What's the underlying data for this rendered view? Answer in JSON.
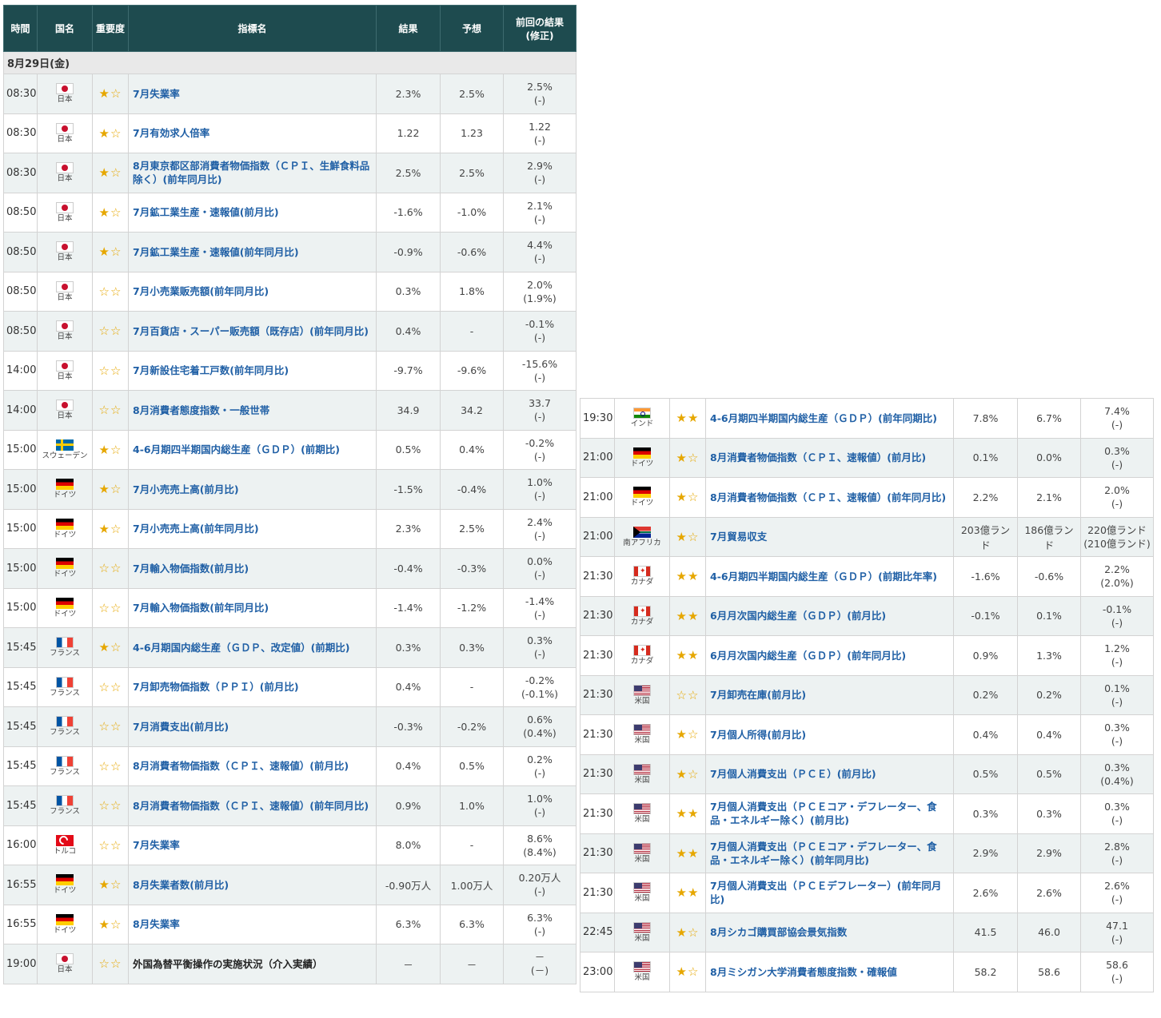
{
  "headers": {
    "time": "時間",
    "country": "国名",
    "importance": "重要度",
    "indicator": "指標名",
    "result": "結果",
    "forecast": "予想",
    "previous": "前回の結果",
    "previous_sub": "(修正)"
  },
  "date_label": "8月29日(金)",
  "left_rows": [
    {
      "time": "08:30",
      "flag": "jp",
      "country": "日本",
      "stars": "★☆",
      "name": "7月失業率",
      "result": "2.3%",
      "forecast": "2.5%",
      "prev": "2.5%",
      "prev_rev": "(-)"
    },
    {
      "time": "08:30",
      "flag": "jp",
      "country": "日本",
      "stars": "★☆",
      "name": "7月有効求人倍率",
      "result": "1.22",
      "forecast": "1.23",
      "prev": "1.22",
      "prev_rev": "(-)"
    },
    {
      "time": "08:30",
      "flag": "jp",
      "country": "日本",
      "stars": "★☆",
      "name": "8月東京都区部消費者物価指数（ＣＰＩ、生鮮食料品除く）(前年同月比)",
      "result": "2.5%",
      "forecast": "2.5%",
      "prev": "2.9%",
      "prev_rev": "(-)"
    },
    {
      "time": "08:50",
      "flag": "jp",
      "country": "日本",
      "stars": "★☆",
      "name": "7月鉱工業生産・速報値(前月比)",
      "result": "-1.6%",
      "forecast": "-1.0%",
      "prev": "2.1%",
      "prev_rev": "(-)"
    },
    {
      "time": "08:50",
      "flag": "jp",
      "country": "日本",
      "stars": "★☆",
      "name": "7月鉱工業生産・速報値(前年同月比)",
      "result": "-0.9%",
      "forecast": "-0.6%",
      "prev": "4.4%",
      "prev_rev": "(-)"
    },
    {
      "time": "08:50",
      "flag": "jp",
      "country": "日本",
      "stars": "☆☆",
      "name": "7月小売業販売額(前年同月比)",
      "result": "0.3%",
      "forecast": "1.8%",
      "prev": "2.0%",
      "prev_rev": "(1.9%)"
    },
    {
      "time": "08:50",
      "flag": "jp",
      "country": "日本",
      "stars": "☆☆",
      "name": "7月百貨店・スーパー販売額（既存店）(前年同月比)",
      "result": "0.4%",
      "forecast": "-",
      "prev": "-0.1%",
      "prev_rev": "(-)"
    },
    {
      "time": "14:00",
      "flag": "jp",
      "country": "日本",
      "stars": "☆☆",
      "name": "7月新設住宅着工戸数(前年同月比)",
      "result": "-9.7%",
      "forecast": "-9.6%",
      "prev": "-15.6%",
      "prev_rev": "(-)"
    },
    {
      "time": "14:00",
      "flag": "jp",
      "country": "日本",
      "stars": "☆☆",
      "name": "8月消費者態度指数・一般世帯",
      "result": "34.9",
      "forecast": "34.2",
      "prev": "33.7",
      "prev_rev": "(-)"
    },
    {
      "time": "15:00",
      "flag": "se",
      "country": "スウェーデン",
      "stars": "★☆",
      "name": "4-6月期四半期国内総生産（ＧＤＰ）(前期比)",
      "result": "0.5%",
      "forecast": "0.4%",
      "prev": "-0.2%",
      "prev_rev": "(-)"
    },
    {
      "time": "15:00",
      "flag": "de",
      "country": "ドイツ",
      "stars": "★☆",
      "name": "7月小売売上高(前月比)",
      "result": "-1.5%",
      "forecast": "-0.4%",
      "prev": "1.0%",
      "prev_rev": "(-)"
    },
    {
      "time": "15:00",
      "flag": "de",
      "country": "ドイツ",
      "stars": "★☆",
      "name": "7月小売売上高(前年同月比)",
      "result": "2.3%",
      "forecast": "2.5%",
      "prev": "2.4%",
      "prev_rev": "(-)"
    },
    {
      "time": "15:00",
      "flag": "de",
      "country": "ドイツ",
      "stars": "☆☆",
      "name": "7月輸入物価指数(前月比)",
      "result": "-0.4%",
      "forecast": "-0.3%",
      "prev": "0.0%",
      "prev_rev": "(-)"
    },
    {
      "time": "15:00",
      "flag": "de",
      "country": "ドイツ",
      "stars": "☆☆",
      "name": "7月輸入物価指数(前年同月比)",
      "result": "-1.4%",
      "forecast": "-1.2%",
      "prev": "-1.4%",
      "prev_rev": "(-)"
    },
    {
      "time": "15:45",
      "flag": "fr",
      "country": "フランス",
      "stars": "★☆",
      "name": "4-6月期国内総生産（ＧＤＰ、改定値）(前期比)",
      "result": "0.3%",
      "forecast": "0.3%",
      "prev": "0.3%",
      "prev_rev": "(-)"
    },
    {
      "time": "15:45",
      "flag": "fr",
      "country": "フランス",
      "stars": "☆☆",
      "name": "7月卸売物価指数（ＰＰＩ）(前月比)",
      "result": "0.4%",
      "forecast": "-",
      "prev": "-0.2%",
      "prev_rev": "(-0.1%)"
    },
    {
      "time": "15:45",
      "flag": "fr",
      "country": "フランス",
      "stars": "☆☆",
      "name": "7月消費支出(前月比)",
      "result": "-0.3%",
      "forecast": "-0.2%",
      "prev": "0.6%",
      "prev_rev": "(0.4%)"
    },
    {
      "time": "15:45",
      "flag": "fr",
      "country": "フランス",
      "stars": "☆☆",
      "name": "8月消費者物価指数（ＣＰＩ、速報値）(前月比)",
      "result": "0.4%",
      "forecast": "0.5%",
      "prev": "0.2%",
      "prev_rev": "(-)"
    },
    {
      "time": "15:45",
      "flag": "fr",
      "country": "フランス",
      "stars": "☆☆",
      "name": "8月消費者物価指数（ＣＰＩ、速報値）(前年同月比)",
      "result": "0.9%",
      "forecast": "1.0%",
      "prev": "1.0%",
      "prev_rev": "(-)"
    },
    {
      "time": "16:00",
      "flag": "tr",
      "country": "トルコ",
      "stars": "☆☆",
      "name": "7月失業率",
      "result": "8.0%",
      "forecast": "-",
      "prev": "8.6%",
      "prev_rev": "(8.4%)"
    },
    {
      "time": "16:55",
      "flag": "de",
      "country": "ドイツ",
      "stars": "★☆",
      "name": "8月失業者数(前月比)",
      "result": "-0.90万人",
      "forecast": "1.00万人",
      "prev": "0.20万人",
      "prev_rev": "(-)"
    },
    {
      "time": "16:55",
      "flag": "de",
      "country": "ドイツ",
      "stars": "★☆",
      "name": "8月失業率",
      "result": "6.3%",
      "forecast": "6.3%",
      "prev": "6.3%",
      "prev_rev": "(-)"
    },
    {
      "time": "19:00",
      "flag": "jp",
      "country": "日本",
      "stars": "☆☆",
      "name": "外国為替平衡操作の実施状況（介入実績）",
      "result": "－",
      "forecast": "－",
      "prev": "－",
      "prev_rev": "(－)",
      "plain": true
    }
  ],
  "right_rows": [
    {
      "time": "19:30",
      "flag": "in",
      "country": "インド",
      "stars": "★★",
      "name": "4-6月期四半期国内総生産（ＧＤＰ）(前年同期比)",
      "result": "7.8%",
      "forecast": "6.7%",
      "prev": "7.4%",
      "prev_rev": "(-)"
    },
    {
      "time": "21:00",
      "flag": "de",
      "country": "ドイツ",
      "stars": "★☆",
      "name": "8月消費者物価指数（ＣＰＩ、速報値）(前月比)",
      "result": "0.1%",
      "forecast": "0.0%",
      "prev": "0.3%",
      "prev_rev": "(-)"
    },
    {
      "time": "21:00",
      "flag": "de",
      "country": "ドイツ",
      "stars": "★☆",
      "name": "8月消費者物価指数（ＣＰＩ、速報値）(前年同月比)",
      "result": "2.2%",
      "forecast": "2.1%",
      "prev": "2.0%",
      "prev_rev": "(-)"
    },
    {
      "time": "21:00",
      "flag": "za",
      "country": "南アフリカ",
      "stars": "★☆",
      "name": "7月貿易収支",
      "result": "203億ランド",
      "forecast": "186億ランド",
      "prev": "220億ランド",
      "prev_rev": "(210億ランド)"
    },
    {
      "time": "21:30",
      "flag": "ca",
      "country": "カナダ",
      "stars": "★★",
      "name": "4-6月期四半期国内総生産（ＧＤＰ）(前期比年率)",
      "result": "-1.6%",
      "forecast": "-0.6%",
      "prev": "2.2%",
      "prev_rev": "(2.0%)"
    },
    {
      "time": "21:30",
      "flag": "ca",
      "country": "カナダ",
      "stars": "★★",
      "name": "6月月次国内総生産（ＧＤＰ）(前月比)",
      "result": "-0.1%",
      "forecast": "0.1%",
      "prev": "-0.1%",
      "prev_rev": "(-)"
    },
    {
      "time": "21:30",
      "flag": "ca",
      "country": "カナダ",
      "stars": "★★",
      "name": "6月月次国内総生産（ＧＤＰ）(前年同月比)",
      "result": "0.9%",
      "forecast": "1.3%",
      "prev": "1.2%",
      "prev_rev": "(-)"
    },
    {
      "time": "21:30",
      "flag": "us",
      "country": "米国",
      "stars": "☆☆",
      "name": "7月卸売在庫(前月比)",
      "result": "0.2%",
      "forecast": "0.2%",
      "prev": "0.1%",
      "prev_rev": "(-)"
    },
    {
      "time": "21:30",
      "flag": "us",
      "country": "米国",
      "stars": "★☆",
      "name": "7月個人所得(前月比)",
      "result": "0.4%",
      "forecast": "0.4%",
      "prev": "0.3%",
      "prev_rev": "(-)"
    },
    {
      "time": "21:30",
      "flag": "us",
      "country": "米国",
      "stars": "★☆",
      "name": "7月個人消費支出（ＰＣＥ）(前月比)",
      "result": "0.5%",
      "forecast": "0.5%",
      "prev": "0.3%",
      "prev_rev": "(0.4%)"
    },
    {
      "time": "21:30",
      "flag": "us",
      "country": "米国",
      "stars": "★★",
      "name": "7月個人消費支出（ＰＣＥコア・デフレーター、食品・エネルギー除く）(前月比)",
      "result": "0.3%",
      "forecast": "0.3%",
      "prev": "0.3%",
      "prev_rev": "(-)"
    },
    {
      "time": "21:30",
      "flag": "us",
      "country": "米国",
      "stars": "★★",
      "name": "7月個人消費支出（ＰＣＥコア・デフレーター、食品・エネルギー除く）(前年同月比)",
      "result": "2.9%",
      "forecast": "2.9%",
      "prev": "2.8%",
      "prev_rev": "(-)"
    },
    {
      "time": "21:30",
      "flag": "us",
      "country": "米国",
      "stars": "★★",
      "name": "7月個人消費支出（ＰＣＥデフレーター）(前年同月比)",
      "result": "2.6%",
      "forecast": "2.6%",
      "prev": "2.6%",
      "prev_rev": "(-)"
    },
    {
      "time": "22:45",
      "flag": "us",
      "country": "米国",
      "stars": "★☆",
      "name": "8月シカゴ購買部協会景気指数",
      "result": "41.5",
      "forecast": "46.0",
      "prev": "47.1",
      "prev_rev": "(-)"
    },
    {
      "time": "23:00",
      "flag": "us",
      "country": "米国",
      "stars": "★☆",
      "name": "8月ミシガン大学消費者態度指数・確報値",
      "result": "58.2",
      "forecast": "58.6",
      "prev": "58.6",
      "prev_rev": "(-)"
    }
  ]
}
